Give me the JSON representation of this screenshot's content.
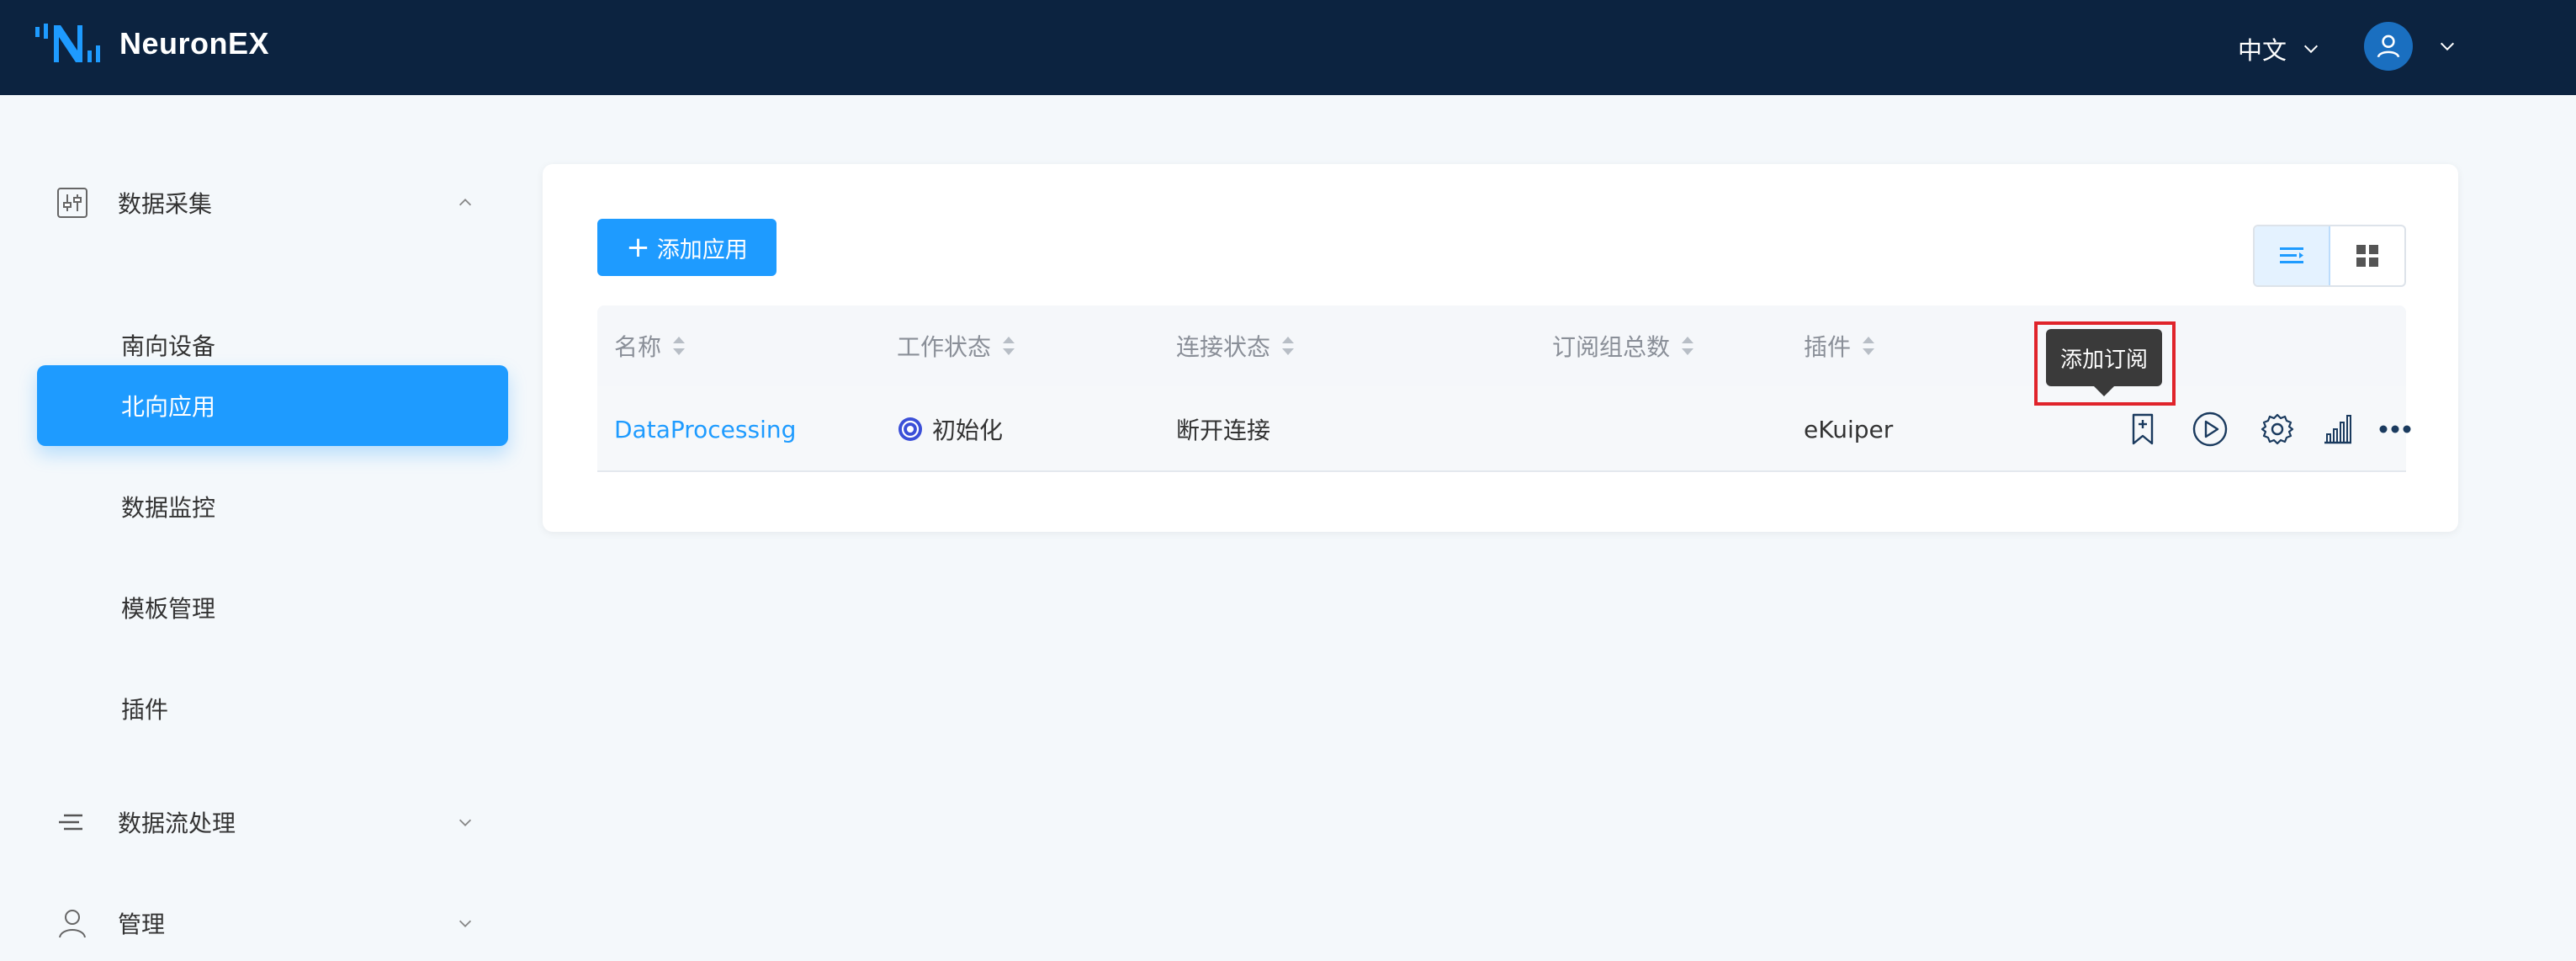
{
  "app": {
    "name": "NeuronEX"
  },
  "header": {
    "language": "中文"
  },
  "sidebar": {
    "groups": [
      {
        "label": "数据采集",
        "icon": "sliders-icon",
        "expanded": true
      },
      {
        "label": "数据流处理",
        "icon": "stream-icon",
        "expanded": false
      },
      {
        "label": "管理",
        "icon": "user-icon",
        "expanded": false
      }
    ],
    "items": [
      {
        "label": "南向设备"
      },
      {
        "label": "北向应用",
        "active": true
      },
      {
        "label": "数据监控"
      },
      {
        "label": "模板管理"
      },
      {
        "label": "插件"
      }
    ]
  },
  "main": {
    "add_button": {
      "plus": "+",
      "label": "添加应用"
    },
    "table": {
      "columns": [
        "名称",
        "工作状态",
        "连接状态",
        "订阅组总数",
        "插件"
      ],
      "rows": [
        {
          "name": "DataProcessing",
          "work_status": "初始化",
          "connection_status": "断开连接",
          "subscription_count": "",
          "plugin": "eKuiper"
        }
      ]
    },
    "tooltip": "添加订阅"
  },
  "colors": {
    "primary": "#1e9bff",
    "header_bg": "#0c2340",
    "highlight": "#e0242b"
  }
}
